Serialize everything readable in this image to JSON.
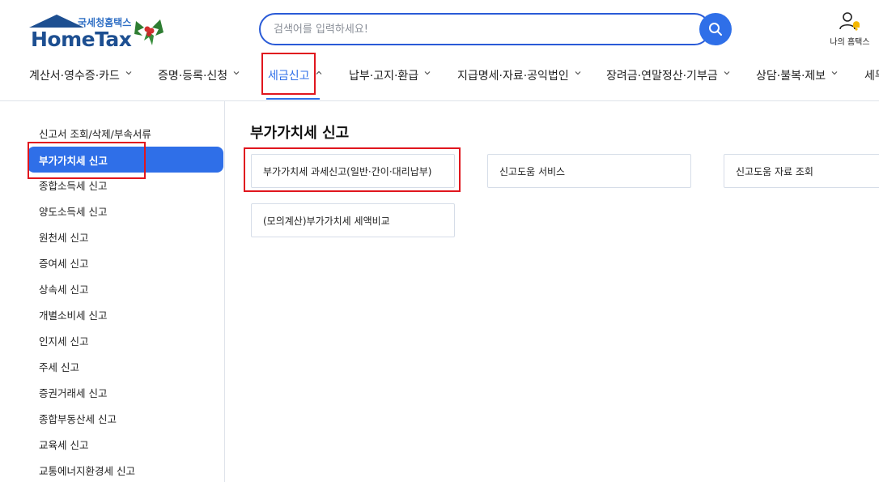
{
  "header": {
    "logo_sub": "국세청홈택스",
    "logo_main": "HomeTax",
    "search_placeholder": "검색어를 입력하세요!",
    "my_hometax_label": "나의 홈택스"
  },
  "gnb": {
    "items": [
      {
        "label": "계산서·영수증·카드"
      },
      {
        "label": "증명·등록·신청"
      },
      {
        "label": "세금신고"
      },
      {
        "label": "납부·고지·환급"
      },
      {
        "label": "지급명세·자료·공익법인"
      },
      {
        "label": "장려금·연말정산·기부금"
      },
      {
        "label": "상담·불복·제보"
      },
      {
        "label": "세무"
      }
    ],
    "active": "세금신고"
  },
  "sidebar": {
    "items": [
      {
        "label": "신고서 조회/삭제/부속서류"
      },
      {
        "label": "부가가치세 신고"
      },
      {
        "label": "종합소득세 신고"
      },
      {
        "label": "양도소득세 신고"
      },
      {
        "label": "원천세 신고"
      },
      {
        "label": "증여세 신고"
      },
      {
        "label": "상속세 신고"
      },
      {
        "label": "개별소비세 신고"
      },
      {
        "label": "인지세 신고"
      },
      {
        "label": "주세 신고"
      },
      {
        "label": "증권거래세 신고"
      },
      {
        "label": "종합부동산세 신고"
      },
      {
        "label": "교육세 신고"
      },
      {
        "label": "교통에너지환경세 신고"
      }
    ],
    "active": "부가가치세 신고"
  },
  "content": {
    "title": "부가가치세 신고",
    "cards": [
      {
        "label": "부가가치세 과세신고(일반·간이·대리납부)"
      },
      {
        "label": "신고도움 서비스"
      },
      {
        "label": "신고도움 자료 조회"
      },
      {
        "label": "(모의계산)부가가치세 세액비교"
      }
    ]
  },
  "colors": {
    "accent": "#2f6fe8",
    "brand": "#1d4f91",
    "annotation": "#e0161e"
  }
}
